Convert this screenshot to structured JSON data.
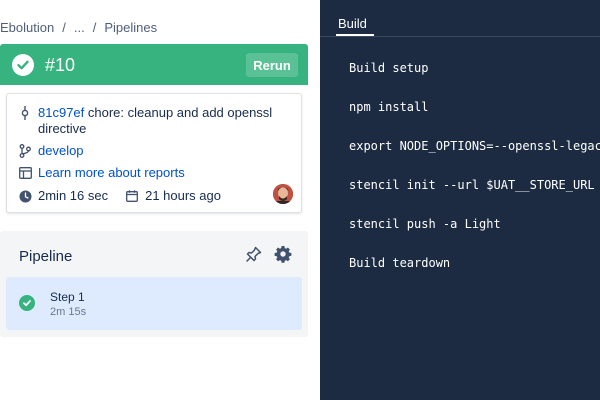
{
  "breadcrumb": {
    "workspace": "Ebolution",
    "ellipsis": "...",
    "current": "Pipelines"
  },
  "run": {
    "status": "successful",
    "number": "#10",
    "rerun_label": "Rerun",
    "accent_color": "#36b37e"
  },
  "details": {
    "commit_hash": "81c97ef",
    "commit_message": "chore: cleanup and add openssl directive",
    "branch": "develop",
    "reports_link": "Learn more about reports",
    "duration": "2min 16 sec",
    "time_ago": "21 hours ago"
  },
  "pipeline": {
    "title": "Pipeline",
    "steps": [
      {
        "name": "Step 1",
        "duration": "2m 15s",
        "status": "successful"
      }
    ]
  },
  "build_log": {
    "tab_label": "Build",
    "lines": [
      "Build setup",
      "npm install",
      "export NODE_OPTIONS=--openssl-legacy",
      "stencil init --url $UAT__STORE_URL -",
      "stencil push -a Light",
      "Build teardown"
    ]
  }
}
